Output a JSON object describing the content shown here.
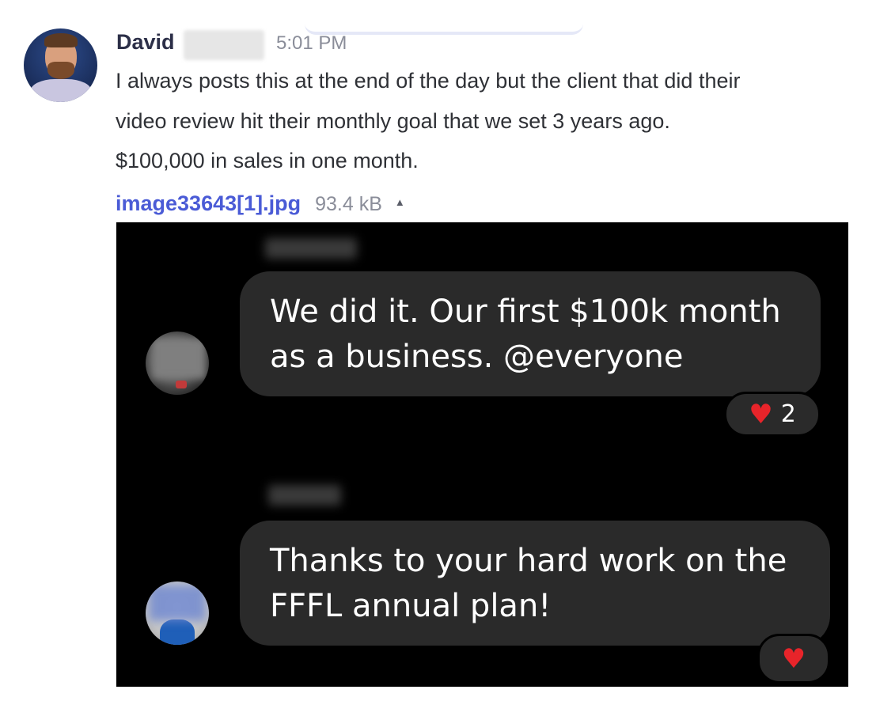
{
  "message": {
    "author": "David",
    "timestamp": "5:01 PM",
    "lines": [
      "I always posts this at the end of the day but the client that did their",
      "video review hit their monthly goal that we set 3 years ago.",
      "$100,000 in sales in one month."
    ],
    "attachment": {
      "filename": "image33643[1].jpg",
      "size": "93.4 kB",
      "toggle_icon": "▲"
    }
  },
  "embedded_image": {
    "chat": [
      {
        "bubble_lines": [
          "We did it. Our first $100k month",
          "as a business. @everyone"
        ],
        "reaction_icon": "heart-icon",
        "reaction_glyph": "♥",
        "reaction_count": "2"
      },
      {
        "bubble_lines": [
          "Thanks to your hard work on the",
          "FFFL annual plan!"
        ],
        "reaction_icon": "heart-icon",
        "reaction_glyph": "♥"
      }
    ]
  },
  "colors": {
    "link": "#4a5bd6",
    "text": "#2f3136",
    "muted": "#8a8d99",
    "bubble": "#2a2a2a",
    "heart": "#e8242a"
  }
}
